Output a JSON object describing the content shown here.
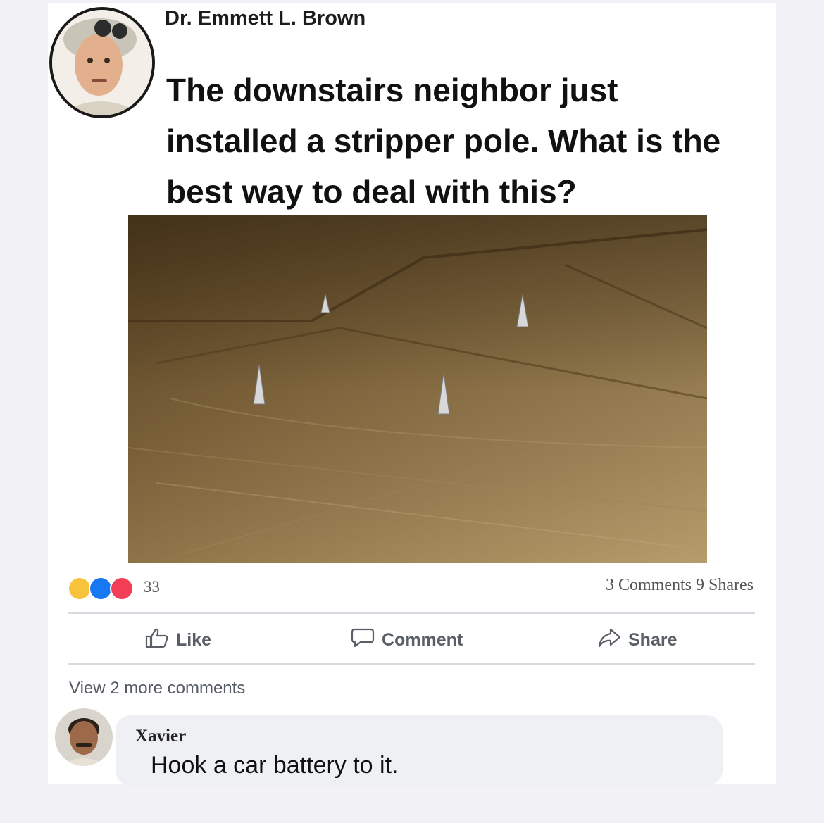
{
  "post": {
    "author": "Dr. Emmett L. Brown",
    "text": "The downstairs neighbor just installed a stripper pole. What is the best way to deal with this?",
    "reaction_icons": [
      "haha-icon",
      "like-icon",
      "love-icon"
    ],
    "reaction_count": "33",
    "comments_shares": "3 Comments  9 Shares"
  },
  "actions": {
    "like": "Like",
    "comment": "Comment",
    "share": "Share"
  },
  "comments": {
    "view_more": "View 2 more comments",
    "items": [
      {
        "name": "Xavier",
        "text": "Hook a car battery to it."
      }
    ]
  },
  "colors": {
    "haha": "#f7c33c",
    "like": "#1877f2",
    "love": "#f33e58"
  }
}
